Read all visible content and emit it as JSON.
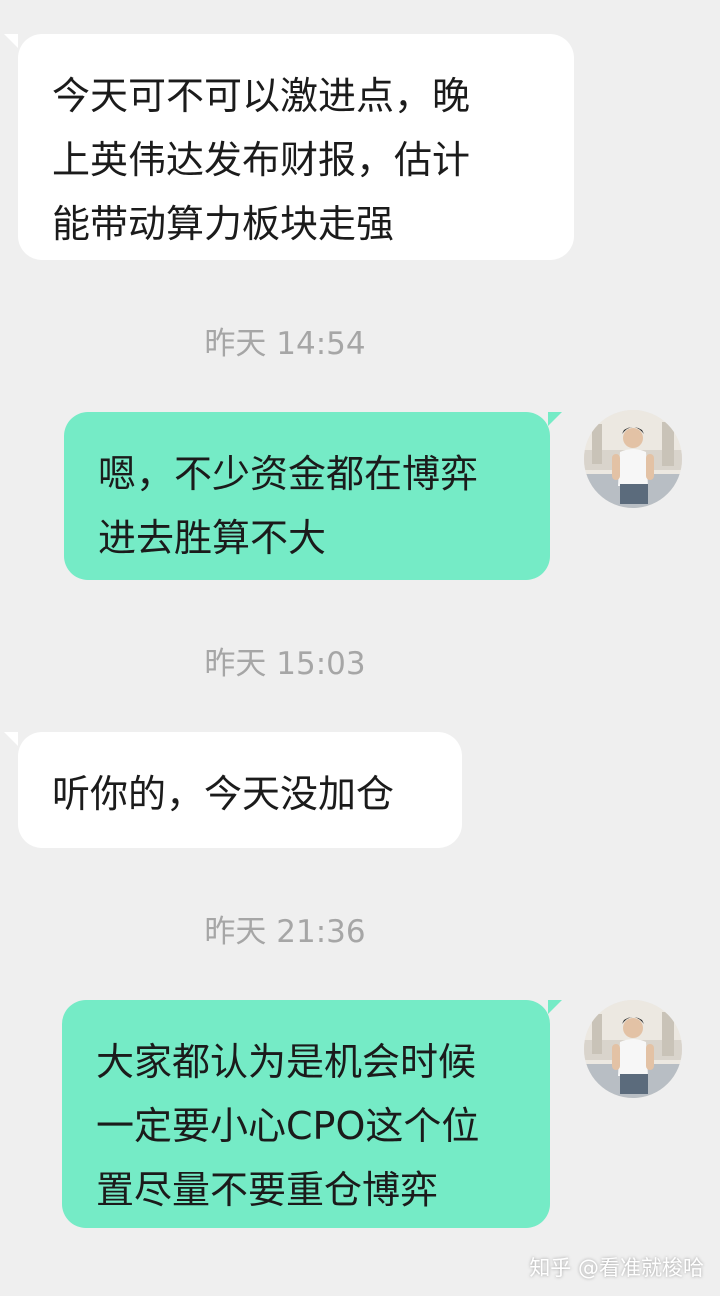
{
  "messages": [
    {
      "side": "in",
      "text": "今天可不可以激进点，晚\n上英伟达发布财报，估计\n能带动算力板块走强"
    },
    {
      "time": "昨天 14:54"
    },
    {
      "side": "out",
      "text": "嗯，不少资金都在博弈\n进去胜算不大",
      "avatar": "user-avatar"
    },
    {
      "time": "昨天 15:03"
    },
    {
      "side": "in",
      "text": "听你的，今天没加仓"
    },
    {
      "time": "昨天 21:36"
    },
    {
      "side": "out",
      "text": "大家都认为是机会时候\n一定要小心CPO这个位\n置尽量不要重仓博弈",
      "avatar": "user-avatar"
    }
  ],
  "watermark": "知乎 @看准就梭哈",
  "colors": {
    "background": "#efefef",
    "incoming_bubble": "#ffffff",
    "outgoing_bubble": "#75ebc6",
    "timestamp_text": "#a6a6a6"
  }
}
